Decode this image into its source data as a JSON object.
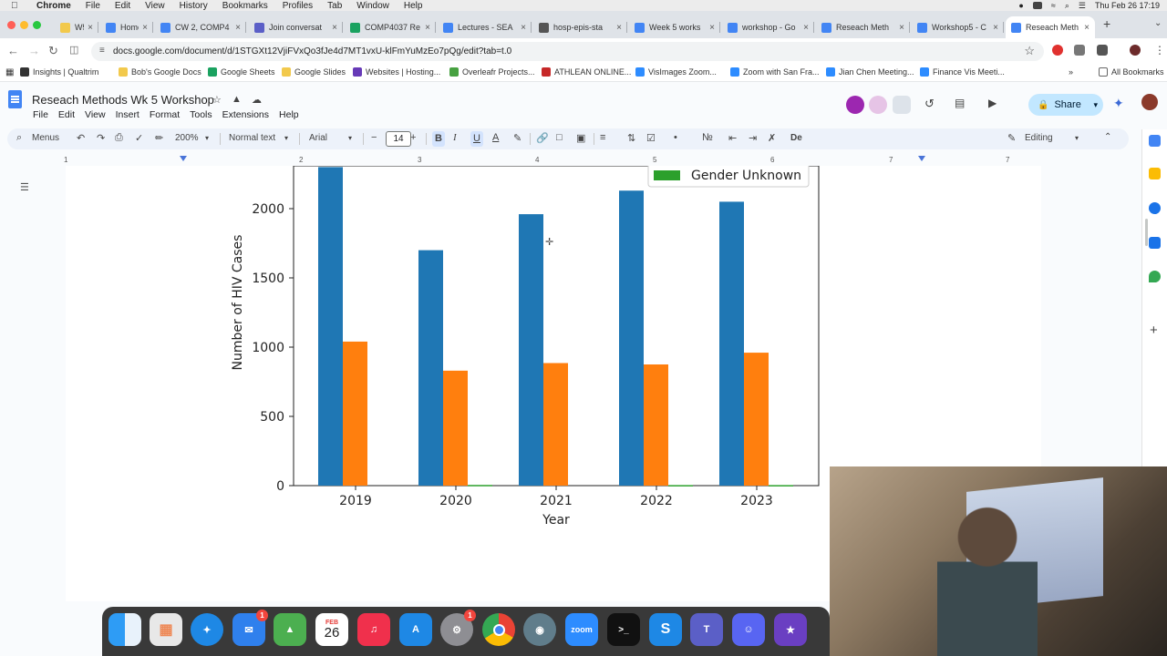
{
  "menubar": {
    "app": "Chrome",
    "items": [
      "File",
      "Edit",
      "View",
      "History",
      "Bookmarks",
      "Profiles",
      "Tab",
      "Window",
      "Help"
    ],
    "datetime": "Thu Feb 26  17:19"
  },
  "tabs": [
    {
      "label": "W5.Vi",
      "color": "#f2c94c"
    },
    {
      "label": "Home",
      "color": "#4285f4"
    },
    {
      "label": "CW 2, COMP4",
      "color": "#4285f4"
    },
    {
      "label": "Join conversat",
      "color": "#5b5fc7"
    },
    {
      "label": "COMP4037 Re",
      "color": "#1aa260"
    },
    {
      "label": "Lectures - SEA",
      "color": "#4285f4"
    },
    {
      "label": "hosp-epis-sta",
      "color": "#555555"
    },
    {
      "label": "Week 5 works",
      "color": "#4285f4"
    },
    {
      "label": "workshop - Go",
      "color": "#4285f4"
    },
    {
      "label": "Reseach Meth",
      "color": "#4285f4"
    },
    {
      "label": "Workshop5 - C",
      "color": "#4285f4"
    },
    {
      "label": "Reseach Meth",
      "color": "#4285f4",
      "active": true
    }
  ],
  "address": {
    "url": "docs.google.com/document/d/1STGXt12VjiFVxQo3fJe4d7MT1vxU-klFmYuMzEo7pQg/edit?tab=t.0"
  },
  "bookmarks": {
    "items": [
      {
        "label": "Insights | Qualtrim",
        "color": "#333333"
      },
      {
        "label": "Bob's Google Docs",
        "color": "#f2c94c"
      },
      {
        "label": "Google Sheets",
        "color": "#1aa260"
      },
      {
        "label": "Google Slides",
        "color": "#f2c94c"
      },
      {
        "label": "Websites | Hosting...",
        "color": "#673ab7"
      },
      {
        "label": "Overleafr Projects...",
        "color": "#47a141"
      },
      {
        "label": "ATHLEAN ONLINE...",
        "color": "#c62828"
      },
      {
        "label": "VisImages Zoom...",
        "color": "#2d8cff"
      },
      {
        "label": "Zoom with San Fra...",
        "color": "#2d8cff"
      },
      {
        "label": "Jian Chen Meeting...",
        "color": "#2d8cff"
      },
      {
        "label": "Finance Vis Meeti...",
        "color": "#2d8cff"
      }
    ],
    "all": "All Bookmarks"
  },
  "doc": {
    "title": "Reseach Methods Wk 5 Workshop",
    "menus": [
      "File",
      "Edit",
      "View",
      "Insert",
      "Format",
      "Tools",
      "Extensions",
      "Help"
    ],
    "share": "Share"
  },
  "toolbar": {
    "menus": "Menus",
    "zoom": "200%",
    "style": "Normal text",
    "font": "Arial",
    "size": "14",
    "mode": "Editing"
  },
  "ruler": [
    "1",
    "2",
    "3",
    "4",
    "5",
    "6",
    "7"
  ],
  "chart_data": {
    "type": "bar",
    "categories": [
      "2019",
      "2020",
      "2021",
      "2022",
      "2023"
    ],
    "series": [
      {
        "name": "",
        "color": "#1f77b4",
        "values": [
          2300,
          1700,
          1960,
          2130,
          2050
        ]
      },
      {
        "name": "",
        "color": "#ff7f0e",
        "values": [
          1040,
          830,
          885,
          875,
          960
        ]
      },
      {
        "name": "Gender Unknown",
        "color": "#2ca02c",
        "values": [
          0,
          5,
          0,
          4,
          4
        ]
      }
    ],
    "title": "",
    "xlabel": "Year",
    "ylabel": "Number of HIV Cases",
    "yticks": [
      "0",
      "500",
      "1000",
      "1500",
      "2000"
    ],
    "ylim": [
      0,
      2250
    ],
    "legend": "top-right"
  },
  "dock": {
    "date_month": "FEB",
    "date_day": "26",
    "mail_badge": "1",
    "chrome_badge": "1",
    "zoom_label": "zoom",
    "terminal_label": ">_",
    "s_label": "S"
  }
}
